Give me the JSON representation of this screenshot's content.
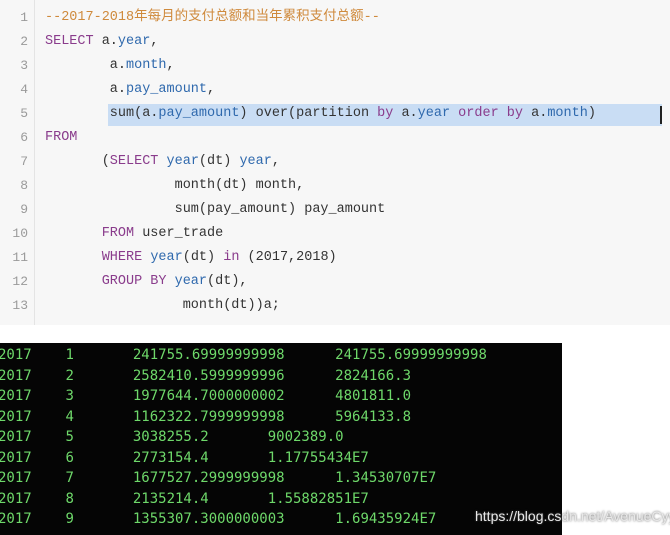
{
  "editor": {
    "lines": [
      {
        "n": "1",
        "indent": 0,
        "tokens": [
          [
            "--2017-2018年每月的支付总额和当年累积支付总额--",
            "comment"
          ]
        ]
      },
      {
        "n": "2",
        "indent": 0,
        "tokens": [
          [
            "SELECT",
            "kw"
          ],
          [
            " a.",
            "plain"
          ],
          [
            "year",
            "prop"
          ],
          [
            ",",
            "plain"
          ]
        ]
      },
      {
        "n": "3",
        "indent": 8,
        "tokens": [
          [
            "a.",
            "plain"
          ],
          [
            "month",
            "prop"
          ],
          [
            ",",
            "plain"
          ]
        ]
      },
      {
        "n": "4",
        "indent": 8,
        "tokens": [
          [
            "a.",
            "plain"
          ],
          [
            "pay_amount",
            "prop"
          ],
          [
            ",",
            "plain"
          ]
        ]
      },
      {
        "n": "5",
        "indent": 8,
        "highlighted": true,
        "tokens": [
          [
            "sum(a.",
            "plain"
          ],
          [
            "pay_amount",
            "prop"
          ],
          [
            ") over(partition ",
            "plain"
          ],
          [
            "by",
            "kw"
          ],
          [
            " a.",
            "plain"
          ],
          [
            "year",
            "prop"
          ],
          [
            " order by",
            "kw"
          ],
          [
            " a.",
            "plain"
          ],
          [
            "month",
            "prop"
          ],
          [
            ")",
            "plain"
          ]
        ]
      },
      {
        "n": "6",
        "indent": 0,
        "tokens": [
          [
            "FROM",
            "kw"
          ]
        ]
      },
      {
        "n": "7",
        "indent": 7,
        "tokens": [
          [
            "(",
            "plain"
          ],
          [
            "SELECT",
            "kw"
          ],
          [
            " ",
            "plain"
          ],
          [
            "year",
            "prop"
          ],
          [
            "(dt) ",
            "plain"
          ],
          [
            "year",
            "prop"
          ],
          [
            ",",
            "plain"
          ]
        ]
      },
      {
        "n": "8",
        "indent": 16,
        "tokens": [
          [
            "month(dt) month,",
            "plain"
          ]
        ]
      },
      {
        "n": "9",
        "indent": 16,
        "tokens": [
          [
            "sum(pay_amount) pay_amount",
            "plain"
          ]
        ]
      },
      {
        "n": "10",
        "indent": 7,
        "tokens": [
          [
            "FROM",
            "kw"
          ],
          [
            " user_trade",
            "plain"
          ]
        ]
      },
      {
        "n": "11",
        "indent": 7,
        "tokens": [
          [
            "WHERE",
            "kw"
          ],
          [
            " ",
            "plain"
          ],
          [
            "year",
            "prop"
          ],
          [
            "(dt) ",
            "plain"
          ],
          [
            "in",
            "kw"
          ],
          [
            " (2017,2018)",
            "plain"
          ]
        ]
      },
      {
        "n": "12",
        "indent": 7,
        "tokens": [
          [
            "GROUP BY",
            "kw"
          ],
          [
            " ",
            "plain"
          ],
          [
            "year",
            "prop"
          ],
          [
            "(dt),",
            "plain"
          ]
        ]
      },
      {
        "n": "13",
        "indent": 17,
        "tokens": [
          [
            "month(dt))a;",
            "plain"
          ]
        ]
      }
    ]
  },
  "terminal": {
    "rows": [
      [
        "2017",
        "1",
        "241755.69999999998",
        "241755.69999999998"
      ],
      [
        "2017",
        "2",
        "2582410.5999999996",
        "2824166.3"
      ],
      [
        "2017",
        "3",
        "1977644.7000000002",
        "4801811.0"
      ],
      [
        "2017",
        "4",
        "1162322.7999999998",
        "5964133.8"
      ],
      [
        "2017",
        "5",
        "3038255.2",
        "9002389.0"
      ],
      [
        "2017",
        "6",
        "2773154.4",
        "1.17755434E7"
      ],
      [
        "2017",
        "7",
        "1677527.2999999998",
        "1.34530707E7"
      ],
      [
        "2017",
        "8",
        "2135214.4",
        "1.55882851E7"
      ],
      [
        "2017",
        "9",
        "1355307.3000000003",
        "1.69435924E7"
      ]
    ]
  },
  "watermark": "https://blog.csdn.net/AvenueCyy"
}
